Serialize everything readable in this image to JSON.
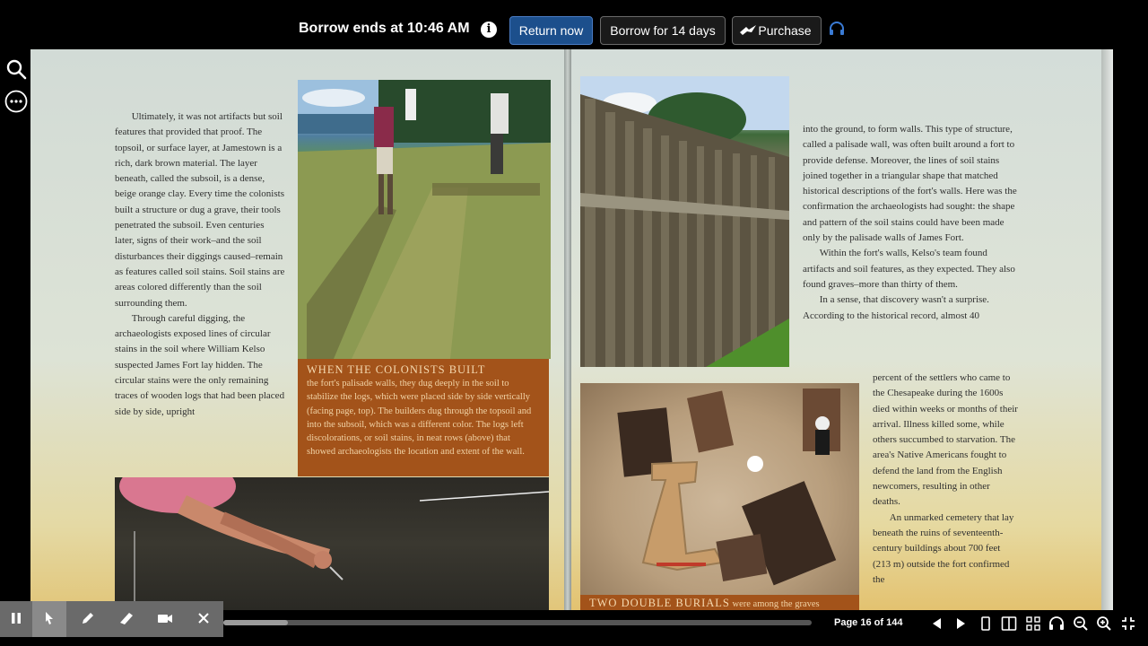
{
  "topbar": {
    "borrow_text": "Borrow ends at 10:46 AM",
    "return_label": "Return now",
    "borrow14_label": "Borrow for 14 days",
    "purchase_label": "Purchase"
  },
  "left_page": {
    "col1_p1": "Ultimately, it was not artifacts but soil features that provided that proof. The topsoil, or surface layer, at Jamestown is a rich, dark brown material. The layer beneath, called the subsoil, is a dense, beige orange clay. Every time the colonists built a structure or dug a grave, their tools penetrated the subsoil. Even centuries later, signs of their work–and the soil disturbances their diggings caused–remain as features called soil stains. Soil stains are areas colored differently than the soil surrounding them.",
    "col1_p2": "Through careful digging, the archaeologists exposed lines of circular stains in the soil where William Kelso suspected James Fort lay hidden. The circular stains were the only remaining traces of wooden logs that had been placed side by side, upright",
    "caption_head": "When the colonists built",
    "caption_body": "the fort's palisade walls, they dug deeply in the soil to stabilize the logs, which were placed side by side vertically (facing page, top). The builders dug through the topsoil and into the subsoil, which was a different color. The logs left discolorations, or soil stains, in neat rows (above) that showed archaeologists the location and extent of the wall."
  },
  "right_page": {
    "col_p1": "into the ground, to form walls. This type of structure, called a palisade wall, was often built around a fort to provide defense. Moreover, the lines of soil stains joined together in a triangular shape that matched historical descriptions of the fort's walls. Here was the confirmation the archaeologists had sought:  the shape and pattern of the soil stains could have been made only by the palisade walls of James Fort.",
    "col_p2": "Within the fort's walls, Kelso's team found artifacts and soil features, as they expected. They also found graves–more than thirty of them.",
    "col_p3a": "In a sense, that discovery wasn't a surprise. According to the historical record, almost 40",
    "col_p3b": "percent of the settlers who came to the Chesapeake during the 1600s died within weeks or months of their arrival. Illness killed some, while others succumbed to starvation. The area's Native Americans fought to defend the land from the English newcomers, resulting in other deaths.",
    "col_p4": "An unmarked cemetery that lay beneath the ruins of seventeenth-century buildings about 700 feet (213 m) outside the fort confirmed the",
    "caption_head": "Two double burials",
    "caption_tail": "were among the graves"
  },
  "bottom": {
    "page_indicator": "Page 16 of 144",
    "progress_fraction": 0.11
  },
  "icons": {
    "info": "info-icon",
    "purchase": "bird-icon",
    "audio": "headphones-icon"
  }
}
